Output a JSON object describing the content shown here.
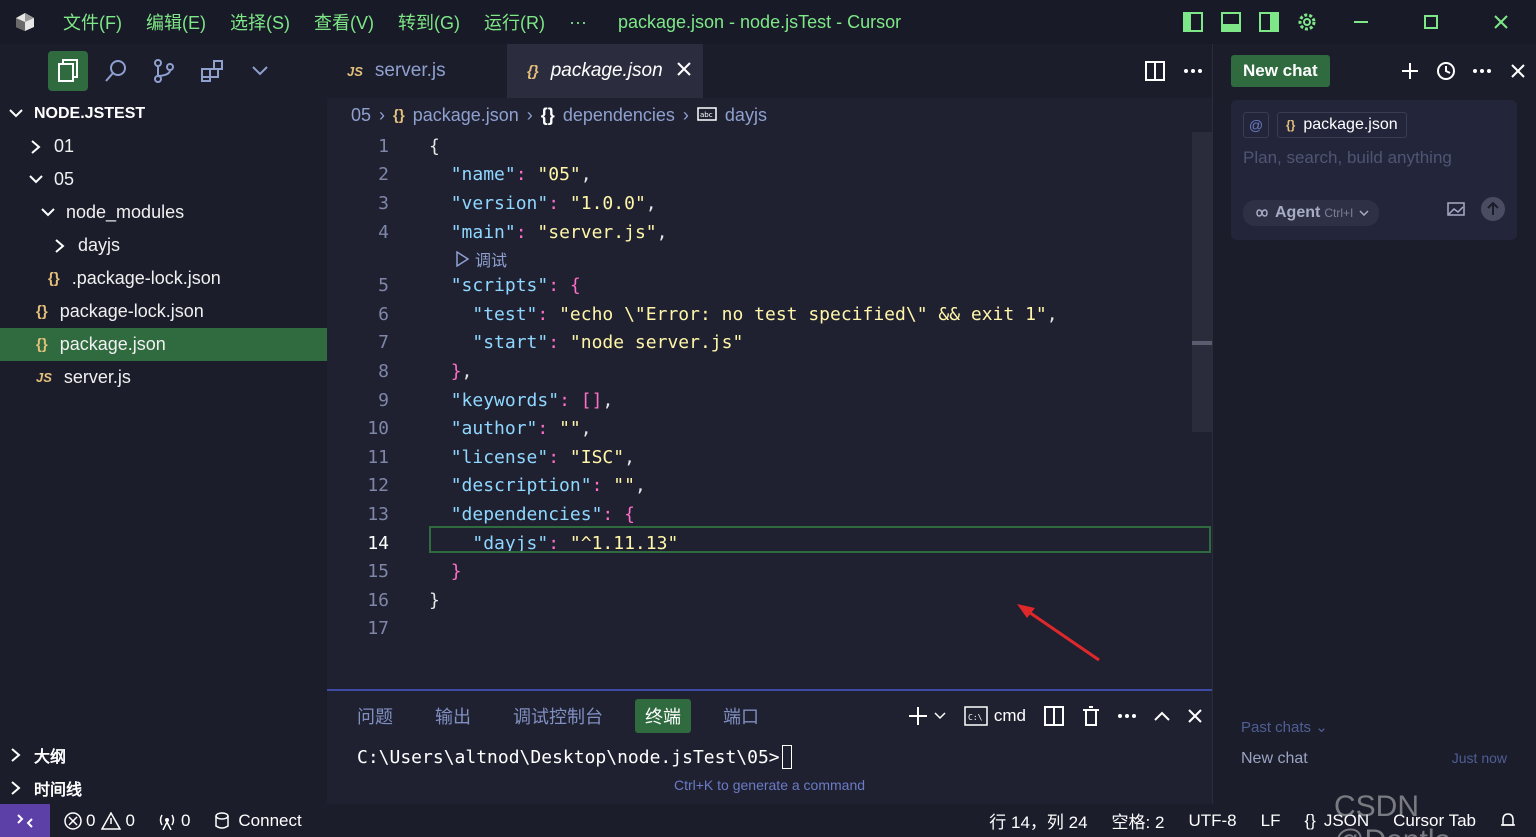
{
  "titlebar": {
    "menus": [
      "文件(F)",
      "编辑(E)",
      "选择(S)",
      "查看(V)",
      "转到(G)",
      "运行(R)",
      "···"
    ],
    "title": "package.json - node.jsTest - Cursor"
  },
  "sidebar": {
    "explorer_title": "NODE.JSTEST",
    "tree": [
      {
        "label": "01",
        "type": "folder",
        "expanded": false,
        "depth": 1
      },
      {
        "label": "05",
        "type": "folder",
        "expanded": true,
        "depth": 1
      },
      {
        "label": "node_modules",
        "type": "folder",
        "expanded": true,
        "depth": 2
      },
      {
        "label": "dayjs",
        "type": "folder",
        "expanded": false,
        "depth": 3
      },
      {
        "label": ".package-lock.json",
        "type": "json",
        "depth": 3
      },
      {
        "label": "package-lock.json",
        "type": "json",
        "depth": 2
      },
      {
        "label": "package.json",
        "type": "json",
        "depth": 2,
        "selected": true
      },
      {
        "label": "server.js",
        "type": "js",
        "depth": 2
      }
    ],
    "outline_label": "大纲",
    "timeline_label": "时间线"
  },
  "editor": {
    "tabs": [
      {
        "label": "server.js",
        "icon": "JS",
        "active": false
      },
      {
        "label": "package.json",
        "icon": "{}",
        "active": true
      }
    ],
    "breadcrumb": [
      "05",
      "package.json",
      "dependencies",
      "dayjs"
    ],
    "codelens": "调试",
    "current_line": 14
  },
  "panel": {
    "tabs": [
      "问题",
      "输出",
      "调试控制台",
      "终端",
      "端口"
    ],
    "active_tab": "终端",
    "shell_label": "cmd",
    "prompt": "C:\\Users\\altnod\\Desktop\\node.jsTest\\05>",
    "hint": "Ctrl+K to generate a command"
  },
  "chat": {
    "new_chat_label": "New chat",
    "context_chip": "package.json",
    "placeholder": "Plan, search, build anything",
    "agent_label": "Agent",
    "agent_shortcut": "Ctrl+I",
    "past_chats_label": "Past chats",
    "history_item": "New chat",
    "history_time": "Just now"
  },
  "statusbar": {
    "errors": "0",
    "warnings": "0",
    "ports": "0",
    "connect": "Connect",
    "position": "行 14，列 24",
    "spaces": "空格: 2",
    "encoding": "UTF-8",
    "eol": "LF",
    "language": "JSON",
    "cursor_tab": "Cursor Tab"
  },
  "watermark": "CSDN @Dontla",
  "colors": {
    "accent_green": "#2f6b3f",
    "menu_text": "#7ee787",
    "key": "#8fd7ff",
    "string": "#fff6a8",
    "bracket": "#ff6ec7",
    "arrow": "#e0282a"
  }
}
